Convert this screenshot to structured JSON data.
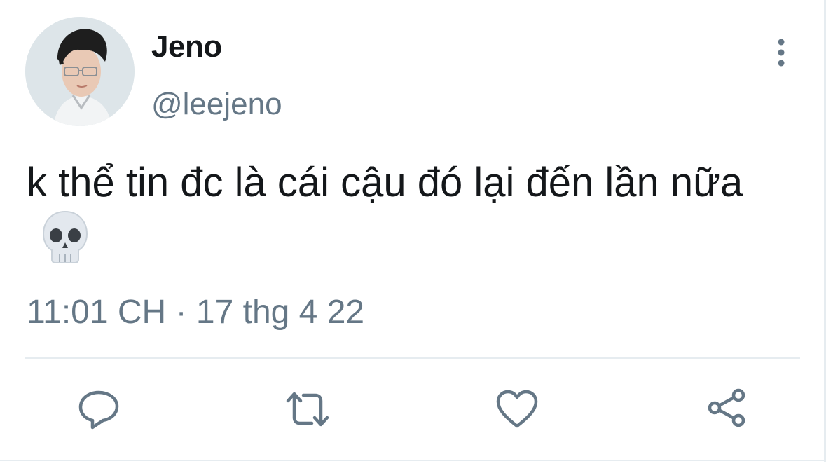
{
  "tweet": {
    "author": {
      "display_name": "Jeno",
      "handle": "@leejeno"
    },
    "text": "k thể tin đc là cái cậu đó lại đến lần nữa",
    "emoji": "skull-emoji",
    "timestamp": "11:01 CH",
    "separator": "·",
    "date": "17 thg 4 22"
  },
  "actions": [
    {
      "name": "reply",
      "icon": "reply-icon"
    },
    {
      "name": "retweet",
      "icon": "retweet-icon"
    },
    {
      "name": "like",
      "icon": "heart-icon"
    },
    {
      "name": "share",
      "icon": "share-icon"
    }
  ],
  "colors": {
    "text_primary": "#14171a",
    "text_secondary": "#657786",
    "divider": "#e6ecf0",
    "icon": "#657786"
  }
}
